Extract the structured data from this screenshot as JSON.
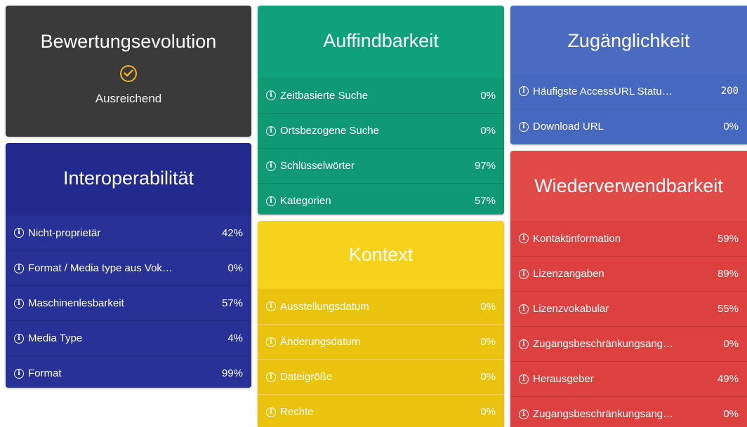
{
  "colors": {
    "bewertung": "#3a3a3a",
    "interoperabilitaet": "#232a8e",
    "auffindbarkeit": "#0fa27a",
    "kontext": "#f7d21a",
    "zugaenglichkeit": "#4a6bc0",
    "wiederverwendbarkeit": "#e24a47",
    "check_accent": "#f0b323"
  },
  "bewertung": {
    "title": "Bewertungsevolution",
    "icon": "check-circle-icon",
    "status": "Ausreichend"
  },
  "interoperabilitaet": {
    "title": "Interoperabilität",
    "rows": [
      {
        "label": "Nicht-proprietär",
        "value": "42%"
      },
      {
        "label": "Format / Media type aus Vok…",
        "value": "0%"
      },
      {
        "label": "Maschinenlesbarkeit",
        "value": "57%"
      },
      {
        "label": "Media Type",
        "value": "4%"
      },
      {
        "label": "Format",
        "value": "99%"
      }
    ]
  },
  "auffindbarkeit": {
    "title": "Auffindbarkeit",
    "rows": [
      {
        "label": "Zeitbasierte Suche",
        "value": "0%"
      },
      {
        "label": "Ortsbezogene Suche",
        "value": "0%"
      },
      {
        "label": "Schlüsselwörter",
        "value": "97%"
      },
      {
        "label": "Kategorien",
        "value": "57%"
      }
    ]
  },
  "kontext": {
    "title": "Kontext",
    "rows": [
      {
        "label": "Ausstellungsdatum",
        "value": "0%"
      },
      {
        "label": "Änderungsdatum",
        "value": "0%"
      },
      {
        "label": "Dateigröße",
        "value": "0%"
      },
      {
        "label": "Rechte",
        "value": "0%"
      }
    ]
  },
  "zugaenglichkeit": {
    "title": "Zugänglichkeit",
    "rows": [
      {
        "label": "Häufigste AccessURL Statu…",
        "value": "200"
      },
      {
        "label": "Download URL",
        "value": "0%"
      }
    ]
  },
  "wiederverwendbarkeit": {
    "title": "Wiederverwendbarkeit",
    "rows": [
      {
        "label": "Kontaktinformation",
        "value": "59%"
      },
      {
        "label": "Lizenzangaben",
        "value": "89%"
      },
      {
        "label": "Lizenzvokabular",
        "value": "55%"
      },
      {
        "label": "Zugangsbeschränkungsang…",
        "value": "0%"
      },
      {
        "label": "Herausgeber",
        "value": "49%"
      },
      {
        "label": "Zugangsbeschränkungsang…",
        "value": "0%"
      }
    ]
  }
}
